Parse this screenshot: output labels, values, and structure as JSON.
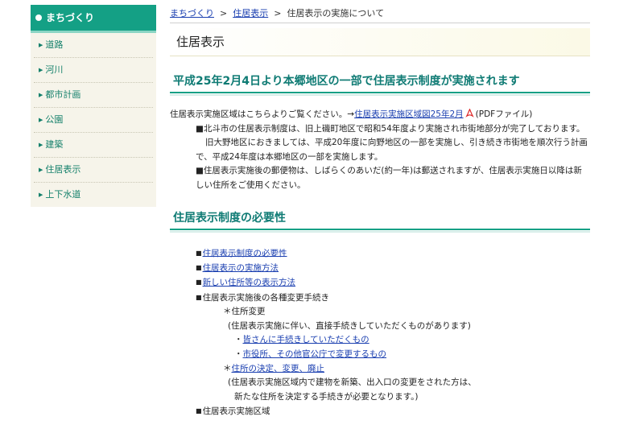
{
  "sidebar": {
    "title": "まちづくり",
    "items": [
      {
        "label": "道路"
      },
      {
        "label": "河川"
      },
      {
        "label": "都市計画"
      },
      {
        "label": "公園"
      },
      {
        "label": "建築"
      },
      {
        "label": "住居表示"
      },
      {
        "label": "上下水道"
      }
    ]
  },
  "breadcrumb": {
    "home": "まちづくり",
    "section": "住居表示",
    "current": "住居表示の実施について",
    "separator": ">"
  },
  "page_title": "住居表示",
  "section1": {
    "heading": "平成25年2月4日より本郷地区の一部で住居表示制度が実施されます",
    "intro_prefix": "住居表示実施区域はこちらよりご覧ください。→",
    "intro_link": "住居表示実施区域図25年2月",
    "intro_suffix": "(PDFファイル)",
    "p1": "■北斗市の住居表示制度は、旧上磯町地区で昭和54年度より実施され市街地部分が完了しております。",
    "p2": "旧大野地区におきましては、平成20年度に向野地区の一部を実施し、引き続き市街地を順次行う計画で、平成24年度は本郷地区の一部を実施します。",
    "p3": "■住居表示実施後の郵便物は、しばらくのあいだ(約一年)は郵送されますが、住居表示実施日以降は新しい住所をご使用ください。"
  },
  "section2": {
    "heading": "住居表示制度の必要性",
    "square": "■",
    "link1": "住居表示制度の必要性",
    "link2": "住居表示の実施方法",
    "link3": "新しい住所等の表示方法",
    "item4": "住居表示実施後の各種変更手続き",
    "sub_title": "＊住所変更",
    "sub_note": "(住居表示実施に伴い、直接手続きしていただくものがあります)",
    "sub_link1": "皆さんに手続きしていただくもの",
    "sub_link2": "市役所、その他官公庁で変更するもの",
    "sub2_link": "住所の決定、変更、廃止",
    "sub2_note1": "(住居表示実施区域内で建物を新築、出入口の変更をされた方は、",
    "sub2_note2": "新たな住所を決定する手続きが必要となります。)",
    "item5": "住居表示実施区域"
  }
}
